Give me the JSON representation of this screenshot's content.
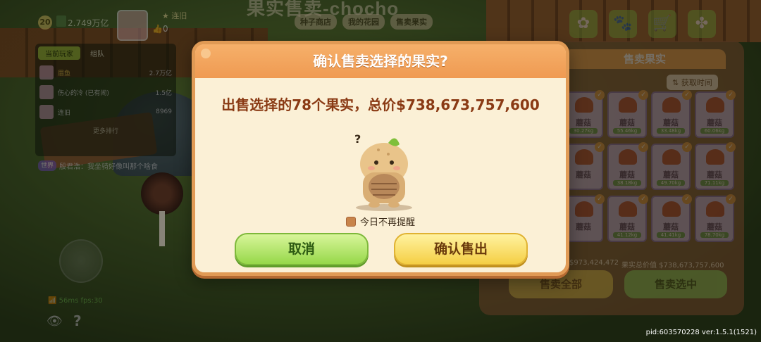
{
  "hud": {
    "title": "果实售卖-chocho",
    "tabs": [
      "种子商店",
      "我的花园",
      "售卖果实"
    ],
    "level": "20",
    "money": "2.749万亿",
    "player_name": "连旧",
    "likes": "0"
  },
  "leaderboard": {
    "tabs": [
      "当前玩家",
      "组队"
    ],
    "rows": [
      {
        "name": "眉鱼",
        "value": "2.7万亿"
      },
      {
        "name": "伤心的冷 (已有闹)",
        "value": "1.5亿"
      },
      {
        "name": "连旧",
        "value": "8969"
      }
    ],
    "more": "更多排行"
  },
  "chat": {
    "tag": "世界",
    "text": "殷君浩：我坐骑好像叫那个啥食"
  },
  "net_status": "56ms fps:30",
  "sale_panel": {
    "title": "售卖果实",
    "sort_label": "⇅ 获取时间",
    "item_name": "蘑菇",
    "weights": [
      "30.27kg",
      "55.46kg",
      "33.48kg",
      "60.06kg",
      "",
      "38.18kg",
      "49.70kg",
      "71.11kg",
      "",
      "41.12kg",
      "41.41kg",
      "78.70kg"
    ],
    "total_left": "973,424,472",
    "total_label": "果实总价值",
    "total_value": "738,673,757,600",
    "sell_all": "售卖全部",
    "sell_selected": "售卖选中"
  },
  "dialog": {
    "title": "确认售卖选择的果实?",
    "message": "出售选择的78个果实，总价$738,673,757,600",
    "reminder": "今日不再提醒",
    "cancel": "取消",
    "confirm": "确认售出"
  },
  "version": "pid:603570228 ver:1.5.1(1521)",
  "colors": {
    "dialog_bg": "#fbf0d6",
    "dialog_header": "#ef9a52",
    "message_text": "#8a3a14",
    "cancel_green": "#97d84a",
    "confirm_yellow": "#f5cf45"
  }
}
